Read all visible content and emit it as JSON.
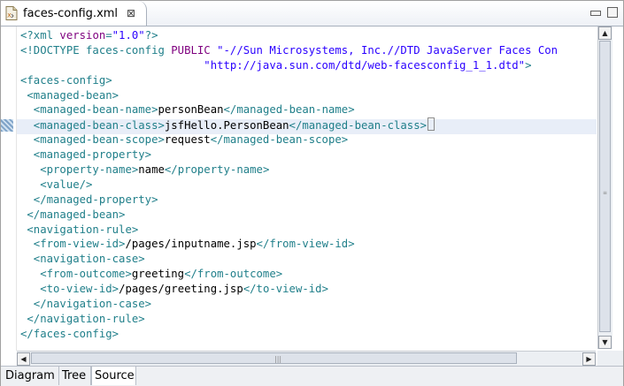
{
  "editor_tab": {
    "title": "faces-config.xml",
    "icon": "xml-file-icon",
    "close_glyph": "⊠"
  },
  "window_controls": [
    "minimize",
    "maximize"
  ],
  "code_lines": [
    [
      {
        "c": "t",
        "v": "<?xml "
      },
      {
        "c": "an",
        "v": "version"
      },
      {
        "c": "t",
        "v": "="
      },
      {
        "c": "av",
        "v": "\"1.0\""
      },
      {
        "c": "t",
        "v": "?>"
      }
    ],
    [
      {
        "c": "t",
        "v": "<!DOCTYPE faces-config "
      },
      {
        "c": "an",
        "v": "PUBLIC"
      },
      {
        "c": "t",
        "v": " "
      },
      {
        "c": "av",
        "v": "\"-//Sun Microsystems, Inc.//DTD JavaServer Faces Con"
      }
    ],
    [
      {
        "c": "av",
        "v": "                            \"http://java.sun.com/dtd/web-facesconfig_1_1.dtd\""
      },
      {
        "c": "t",
        "v": ">"
      }
    ],
    [
      {
        "c": "t",
        "v": "<faces-config>"
      }
    ],
    [
      {
        "c": "t",
        "v": " <managed-bean>"
      }
    ],
    [
      {
        "c": "t",
        "v": "  <managed-bean-name>"
      },
      {
        "c": "txt",
        "v": "personBean"
      },
      {
        "c": "t",
        "v": "</managed-bean-name>"
      }
    ],
    [
      {
        "c": "t",
        "v": "  <managed-bean-class>"
      },
      {
        "c": "txt",
        "v": "jsfHello.PersonBean"
      },
      {
        "c": "t",
        "v": "</managed-bean-class>"
      },
      {
        "c": "caret",
        "v": ""
      }
    ],
    [
      {
        "c": "t",
        "v": "  <managed-bean-scope>"
      },
      {
        "c": "txt",
        "v": "request"
      },
      {
        "c": "t",
        "v": "</managed-bean-scope>"
      }
    ],
    [
      {
        "c": "t",
        "v": "  <managed-property>"
      }
    ],
    [
      {
        "c": "t",
        "v": "   <property-name>"
      },
      {
        "c": "txt",
        "v": "name"
      },
      {
        "c": "t",
        "v": "</property-name>"
      }
    ],
    [
      {
        "c": "t",
        "v": "   <value/>"
      }
    ],
    [
      {
        "c": "t",
        "v": "  </managed-property>"
      }
    ],
    [
      {
        "c": "t",
        "v": " </managed-bean>"
      }
    ],
    [
      {
        "c": "t",
        "v": " <navigation-rule>"
      }
    ],
    [
      {
        "c": "t",
        "v": "  <from-view-id>"
      },
      {
        "c": "txt",
        "v": "/pages/inputname.jsp"
      },
      {
        "c": "t",
        "v": "</from-view-id>"
      }
    ],
    [
      {
        "c": "t",
        "v": "  <navigation-case>"
      }
    ],
    [
      {
        "c": "t",
        "v": "   <from-outcome>"
      },
      {
        "c": "txt",
        "v": "greeting"
      },
      {
        "c": "t",
        "v": "</from-outcome>"
      }
    ],
    [
      {
        "c": "t",
        "v": "   <to-view-id>"
      },
      {
        "c": "txt",
        "v": "/pages/greeting.jsp"
      },
      {
        "c": "t",
        "v": "</to-view-id>"
      }
    ],
    [
      {
        "c": "t",
        "v": "  </navigation-case>"
      }
    ],
    [
      {
        "c": "t",
        "v": " </navigation-rule>"
      }
    ],
    [
      {
        "c": "t",
        "v": "</faces-config>"
      }
    ]
  ],
  "colors": {
    "tag": "#207f8a",
    "attribute_name": "#7f007f",
    "attribute_value": "#2a00ff",
    "text": "#000000",
    "current_line": "#e8eef8"
  },
  "bottom_tabs": [
    {
      "label": "Diagram",
      "selected": false
    },
    {
      "label": "Tree",
      "selected": false
    },
    {
      "label": "Source",
      "selected": true
    }
  ]
}
